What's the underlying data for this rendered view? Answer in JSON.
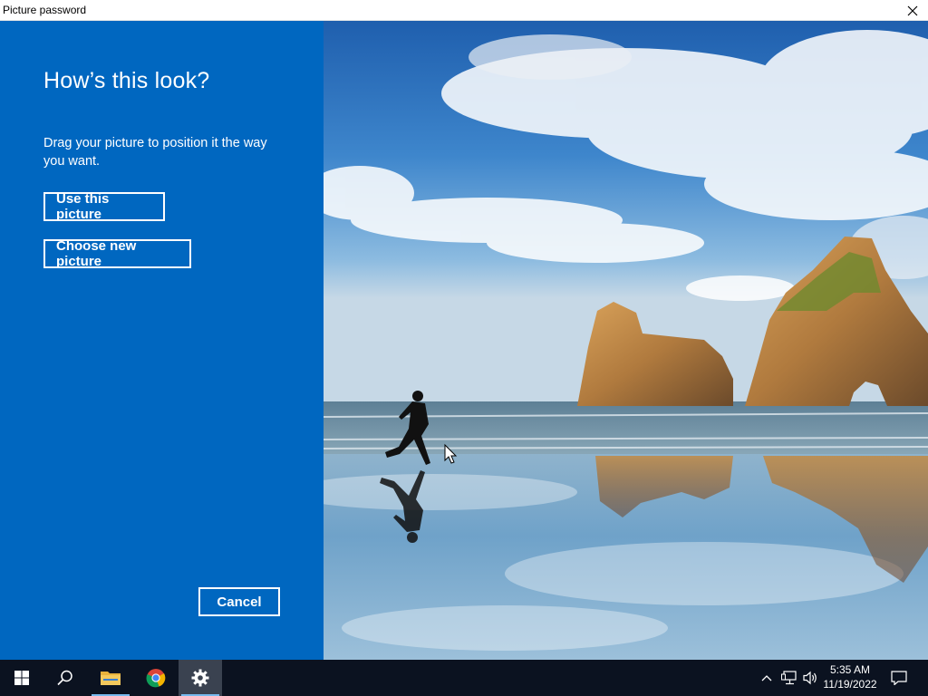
{
  "window": {
    "title": "Picture password"
  },
  "panel": {
    "heading": "How’s this look?",
    "description": "Drag your picture to position it the way you want.",
    "use_button": "Use this picture",
    "choose_button": "Choose new picture",
    "cancel_button": "Cancel"
  },
  "taskbar": {
    "time": "5:35 AM",
    "date": "11/19/2022",
    "items": [
      "start-icon",
      "search-icon",
      "file-explorer-icon",
      "chrome-icon",
      "settings-icon"
    ]
  },
  "colors": {
    "panel": "#0067c0",
    "taskbar": "#0b1220",
    "accent_underline": "#76b9ed"
  }
}
